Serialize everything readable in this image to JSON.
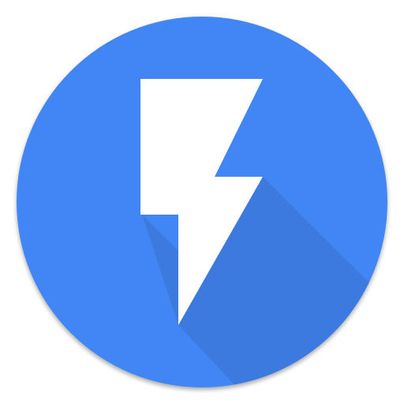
{
  "icon": {
    "name": "lightning-bolt-icon",
    "colors": {
      "circle": "#4285F4",
      "circle_edge": "#3B78DB",
      "long_shadow": "#3C7AE0",
      "bolt": "#FFFFFF",
      "page_background": "#FFFFFF"
    }
  }
}
